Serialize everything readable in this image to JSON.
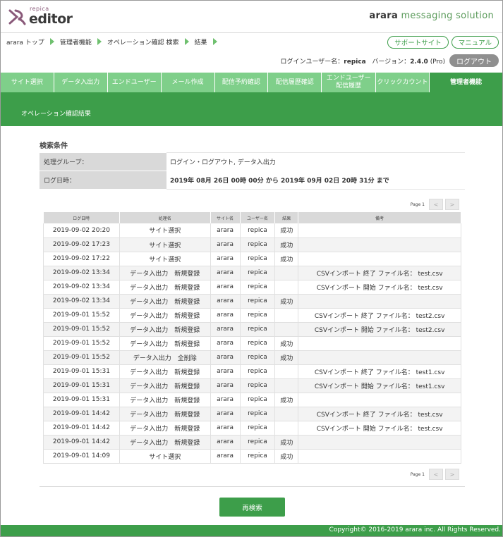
{
  "logo": {
    "small": "repica",
    "big": "editor"
  },
  "brand": {
    "bold": "arara",
    "rest": "messaging solution"
  },
  "breadcrumb": [
    "arara トップ",
    "管理者機能",
    "オペレーション確認 検索",
    "結果"
  ],
  "top_buttons": {
    "support": "サポートサイト",
    "manual": "マニュアル"
  },
  "user": {
    "label": "ログインユーザー名：",
    "name": "repica",
    "version_label": "バージョン：",
    "version": "2.4.0",
    "edition": "(Pro)",
    "logout": "ログアウト"
  },
  "nav": [
    {
      "label": "サイト選択"
    },
    {
      "label": "データ入出力"
    },
    {
      "label": "エンドユーザー"
    },
    {
      "label": "メール作成"
    },
    {
      "label": "配信予約確認"
    },
    {
      "label": "配信履歴確認"
    },
    {
      "label": "エンドユーザー\n配信履歴"
    },
    {
      "label": "クリックカウント"
    },
    {
      "label": "管理者機能",
      "active": true
    }
  ],
  "subheader": "オペレーション確認結果",
  "conditions": {
    "title": "検索条件",
    "group_label": "処理グループ：",
    "group_value": "ログイン・ログアウト, データ入出力",
    "date_label": "ログ日時：",
    "date_value": "2019年 08月 26日 00時 00分 から 2019年 09月 02日 20時 31分 まで"
  },
  "pager": {
    "label": "Page 1",
    "prev": "<",
    "next": ">"
  },
  "table": {
    "headers": [
      "ログ日時",
      "処理名",
      "サイト名",
      "ユーザー名",
      "結果",
      "備考"
    ],
    "rows": [
      [
        "2019-09-02 20:20",
        "サイト選択",
        "arara",
        "repica",
        "成功",
        ""
      ],
      [
        "2019-09-02 17:23",
        "サイト選択",
        "arara",
        "repica",
        "成功",
        ""
      ],
      [
        "2019-09-02 17:22",
        "サイト選択",
        "arara",
        "repica",
        "成功",
        ""
      ],
      [
        "2019-09-02 13:34",
        "データ入出力　新規登録",
        "arara",
        "repica",
        "",
        "CSVインポート 終了 ファイル名： test.csv"
      ],
      [
        "2019-09-02 13:34",
        "データ入出力　新規登録",
        "arara",
        "repica",
        "",
        "CSVインポート 開始 ファイル名： test.csv"
      ],
      [
        "2019-09-02 13:34",
        "データ入出力　新規登録",
        "arara",
        "repica",
        "成功",
        ""
      ],
      [
        "2019-09-01 15:52",
        "データ入出力　新規登録",
        "arara",
        "repica",
        "",
        "CSVインポート 終了 ファイル名： test2.csv"
      ],
      [
        "2019-09-01 15:52",
        "データ入出力　新規登録",
        "arara",
        "repica",
        "",
        "CSVインポート 開始 ファイル名： test2.csv"
      ],
      [
        "2019-09-01 15:52",
        "データ入出力　新規登録",
        "arara",
        "repica",
        "成功",
        ""
      ],
      [
        "2019-09-01 15:52",
        "データ入出力　全削除",
        "arara",
        "repica",
        "成功",
        ""
      ],
      [
        "2019-09-01 15:31",
        "データ入出力　新規登録",
        "arara",
        "repica",
        "",
        "CSVインポート 終了 ファイル名： test1.csv"
      ],
      [
        "2019-09-01 15:31",
        "データ入出力　新規登録",
        "arara",
        "repica",
        "",
        "CSVインポート 開始 ファイル名： test1.csv"
      ],
      [
        "2019-09-01 15:31",
        "データ入出力　新規登録",
        "arara",
        "repica",
        "成功",
        ""
      ],
      [
        "2019-09-01 14:42",
        "データ入出力　新規登録",
        "arara",
        "repica",
        "",
        "CSVインポート 終了 ファイル名： test.csv"
      ],
      [
        "2019-09-01 14:42",
        "データ入出力　新規登録",
        "arara",
        "repica",
        "",
        "CSVインポート 開始 ファイル名： test.csv"
      ],
      [
        "2019-09-01 14:42",
        "データ入出力　新規登録",
        "arara",
        "repica",
        "成功",
        ""
      ],
      [
        "2019-09-01 14:09",
        "サイト選択",
        "arara",
        "repica",
        "成功",
        ""
      ]
    ]
  },
  "research_button": "再検索",
  "footer": "Copyright© 2016-2019 arara inc. All Rights Reserved.",
  "colors": {
    "accent": "#3d9e4a",
    "tab": "#7fcf8a",
    "header_cell": "#d9d9d9"
  }
}
